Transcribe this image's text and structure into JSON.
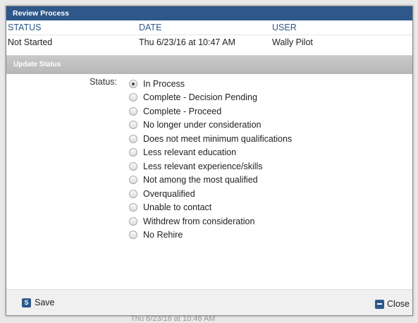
{
  "panel": {
    "title": "Review Process"
  },
  "grid": {
    "headers": [
      "STATUS",
      "DATE",
      "USER"
    ],
    "row": [
      "Not Started",
      "Thu 6/23/16 at 10:47 AM",
      "Wally Pilot"
    ]
  },
  "update_section": {
    "title": "Update Status"
  },
  "form": {
    "status_label": "Status:",
    "options": [
      "In Process",
      "Complete - Decision Pending",
      "Complete - Proceed",
      "No longer under consideration",
      "Does not meet minimum qualifications",
      "Less relevant education",
      "Less relevant experience/skills",
      "Not among the most qualified",
      "Overqualified",
      "Unable to contact",
      "Withdrew from consideration",
      "No Rehire"
    ],
    "selected": "In Process"
  },
  "footer": {
    "save_label": "Save",
    "save_icon_letter": "S",
    "close_label": "Close"
  },
  "background": {
    "peek_text": "Thu 6/23/16 at 10:46 AM"
  },
  "colors": {
    "accent": "#2d5889",
    "section_header": "#bfbfbf"
  }
}
